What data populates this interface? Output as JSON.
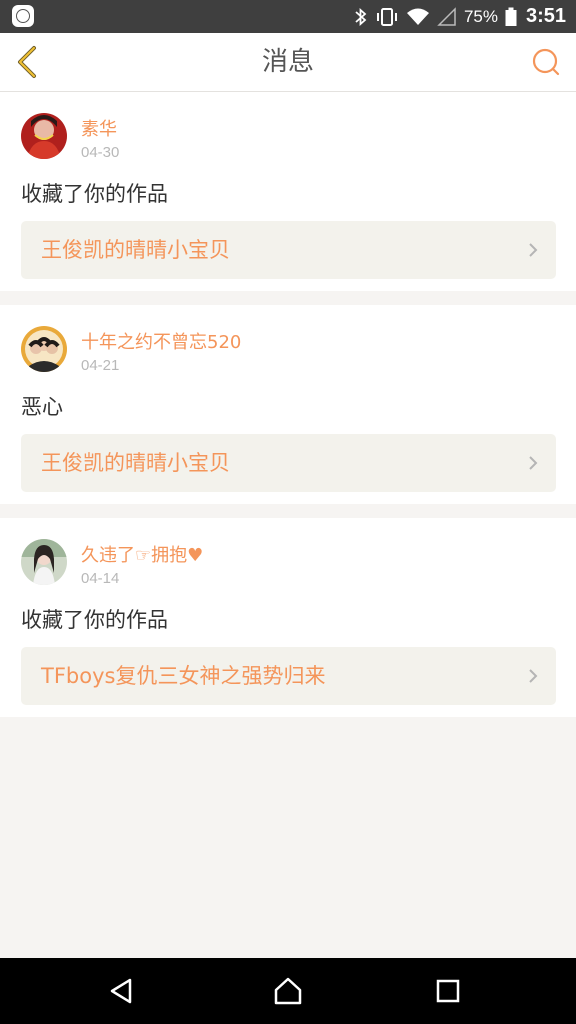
{
  "status_bar": {
    "battery_percent": "75%",
    "time": "3:51"
  },
  "header": {
    "title": "消息"
  },
  "messages": [
    {
      "user": "素华",
      "date": "04-30",
      "action": "收藏了你的作品",
      "work_title": "王俊凯的晴晴小宝贝"
    },
    {
      "user": "十年之约不曾忘520",
      "date": "04-21",
      "action": "恶心",
      "work_title": "王俊凯的晴晴小宝贝"
    },
    {
      "user": "久违了☞拥抱♥",
      "date": "04-14",
      "action": "收藏了你的作品",
      "work_title": "TFboys复仇三女神之强势归来"
    }
  ],
  "colors": {
    "accent": "#f4955a",
    "header_bg": "#ffffff",
    "status_bar_bg": "#3f3f3f",
    "nav_bar_bg": "#000000",
    "page_bg": "#f6f4f2",
    "link_bg": "#f3f2ec"
  },
  "icons": {
    "back": "chevron-left-icon",
    "search": "search-icon",
    "nav_back": "triangle-back-icon",
    "nav_home": "home-icon",
    "nav_recents": "square-recents-icon"
  }
}
